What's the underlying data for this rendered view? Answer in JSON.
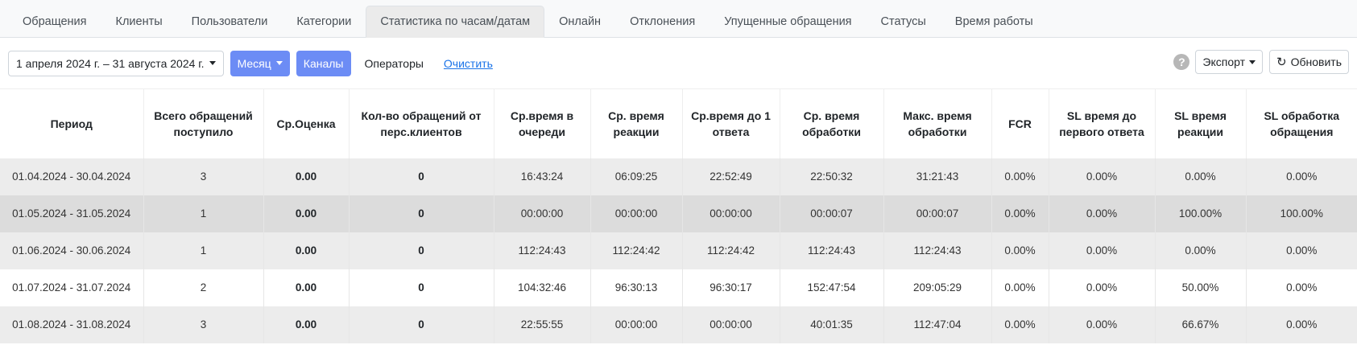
{
  "tabs": [
    {
      "label": "Обращения",
      "active": false
    },
    {
      "label": "Клиенты",
      "active": false
    },
    {
      "label": "Пользователи",
      "active": false
    },
    {
      "label": "Категории",
      "active": false
    },
    {
      "label": "Статистика по часам/датам",
      "active": true
    },
    {
      "label": "Онлайн",
      "active": false
    },
    {
      "label": "Отклонения",
      "active": false
    },
    {
      "label": "Упущенные обращения",
      "active": false
    },
    {
      "label": "Статусы",
      "active": false
    },
    {
      "label": "Время работы",
      "active": false
    }
  ],
  "toolbar": {
    "date_range": "1 апреля 2024 г. – 31 августа 2024 г.",
    "group_by": "Месяц",
    "channels": "Каналы",
    "operators": "Операторы",
    "clear": "Очистить",
    "help": "?",
    "export": "Экспорт",
    "refresh": "Обновить",
    "accent_color": "#6c8cf5"
  },
  "table": {
    "headers": [
      "Период",
      "Всего обращений поступило",
      "Ср.Оценка",
      "Кол-во обращений от перс.клиентов",
      "Ср.время в очереди",
      "Ср. время реакции",
      "Ср.время до 1 ответа",
      "Ср. время обработки",
      "Макс. время обработки",
      "FCR",
      "SL время до первого ответа",
      "SL время реакции",
      "SL обработка обращения"
    ],
    "rows": [
      [
        "01.04.2024 - 30.04.2024",
        "3",
        "0.00",
        "0",
        "16:43:24",
        "06:09:25",
        "22:52:49",
        "22:50:32",
        "31:21:43",
        "0.00%",
        "0.00%",
        "0.00%",
        "0.00%"
      ],
      [
        "01.05.2024 - 31.05.2024",
        "1",
        "0.00",
        "0",
        "00:00:00",
        "00:00:00",
        "00:00:00",
        "00:00:07",
        "00:00:07",
        "0.00%",
        "0.00%",
        "100.00%",
        "100.00%"
      ],
      [
        "01.06.2024 - 30.06.2024",
        "1",
        "0.00",
        "0",
        "112:24:43",
        "112:24:42",
        "112:24:42",
        "112:24:43",
        "112:24:43",
        "0.00%",
        "0.00%",
        "0.00%",
        "0.00%"
      ],
      [
        "01.07.2024 - 31.07.2024",
        "2",
        "0.00",
        "0",
        "104:32:46",
        "96:30:13",
        "96:30:17",
        "152:47:54",
        "209:05:29",
        "0.00%",
        "0.00%",
        "50.00%",
        "0.00%"
      ],
      [
        "01.08.2024 - 31.08.2024",
        "3",
        "0.00",
        "0",
        "22:55:55",
        "00:00:00",
        "00:00:00",
        "40:01:35",
        "112:47:04",
        "0.00%",
        "0.00%",
        "66.67%",
        "0.00%"
      ]
    ]
  }
}
